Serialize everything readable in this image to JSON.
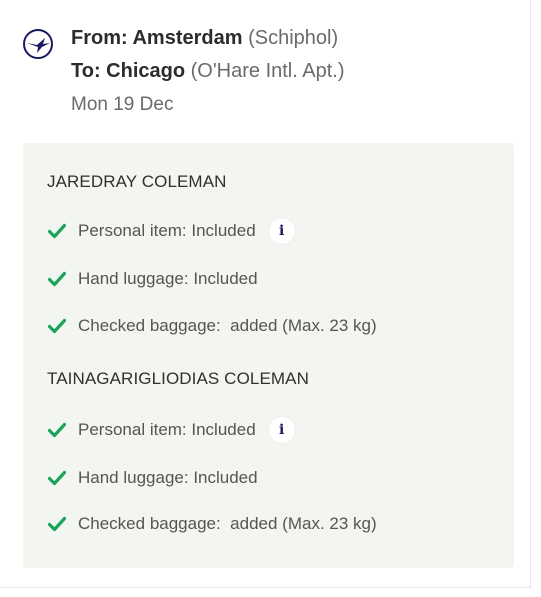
{
  "flight": {
    "from_label": "From: Amsterdam",
    "from_detail": "(Schiphol)",
    "to_label": "To: Chicago",
    "to_detail": "(O'Hare Intl. Apt.)",
    "date": "Mon 19 Dec",
    "airline_icon": "crane-logo-icon"
  },
  "passengers": [
    {
      "name": "JAREDRAY COLEMAN",
      "items": [
        {
          "text": "Personal item: Included",
          "has_info": true
        },
        {
          "text": "Hand luggage: Included",
          "has_info": false
        },
        {
          "text": "Checked baggage:  added (Max. 23 kg)",
          "has_info": false
        }
      ]
    },
    {
      "name": "TAINAGARIGLIODIAS COLEMAN",
      "items": [
        {
          "text": "Personal item: Included",
          "has_info": true
        },
        {
          "text": "Hand luggage: Included",
          "has_info": false
        },
        {
          "text": "Checked baggage:  added (Max. 23 kg)",
          "has_info": false
        }
      ]
    }
  ],
  "info_glyph": "i",
  "colors": {
    "check": "#1aa35a",
    "panel": "#f3f5f1",
    "info": "#1a1a5e"
  }
}
